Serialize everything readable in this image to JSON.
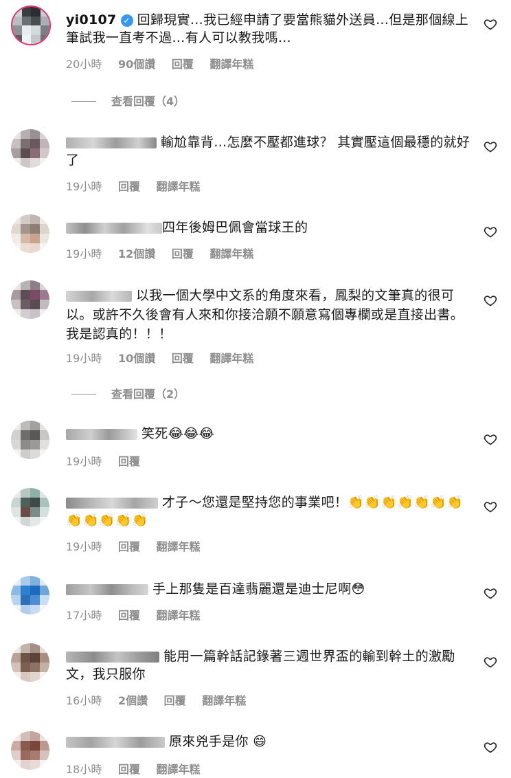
{
  "comments": [
    {
      "username": "yi0107",
      "verified": true,
      "text": "回歸現實…我已經申請了要當熊貓外送員…但是那個線上筆試我一直考不過…有人可以教我嗎…",
      "time": "20小時",
      "likes": "90個讚",
      "reply": "回覆",
      "translate": "翻譯年糕",
      "view_replies": "查看回覆（4）"
    },
    {
      "text": "輸尬靠背…怎麼不壓都進球？ 其實壓這個最穩的就好了",
      "time": "19小時",
      "reply": "回覆",
      "translate": "翻譯年糕"
    },
    {
      "text": "四年後姆巴佩會當球王的",
      "time": "19小時",
      "likes": "12個讚",
      "reply": "回覆",
      "translate": "翻譯年糕"
    },
    {
      "text": "以我一個大學中文系的角度來看，鳳梨的文筆真的很可以。或許不久後會有人來和你接洽願不願意寫個專欄或是直接出書。我是認真的！！！",
      "time": "19小時",
      "likes": "10個讚",
      "reply": "回覆",
      "translate": "翻譯年糕",
      "view_replies": "查看回覆（2）"
    },
    {
      "text": "笑死😂😂😂",
      "time": "19小時",
      "reply": "回覆"
    },
    {
      "text": "才子～您還是堅持您的事業吧！👏👏👏👏👏👏👏👏👏👏👏👏",
      "time": "19小時",
      "reply": "回覆",
      "translate": "翻譯年糕"
    },
    {
      "text": "手上那隻是百達翡麗還是迪士尼啊😳",
      "time": "17小時",
      "reply": "回覆",
      "translate": "翻譯年糕"
    },
    {
      "text": "能用一篇幹話記錄著三週世界盃的輸到幹土的激勵文，我只服你",
      "time": "16小時",
      "likes": "2個讚",
      "reply": "回覆",
      "translate": "翻譯年糕"
    },
    {
      "text": "原來兇手是你 😄",
      "time": "18小時",
      "reply": "回覆",
      "translate": "翻譯年糕"
    }
  ],
  "colors": {
    "meta": "#8e8e8e",
    "verified": "#3897f0"
  },
  "icons": {
    "like": "heart-outline-icon",
    "verified": "verified-badge-icon"
  }
}
